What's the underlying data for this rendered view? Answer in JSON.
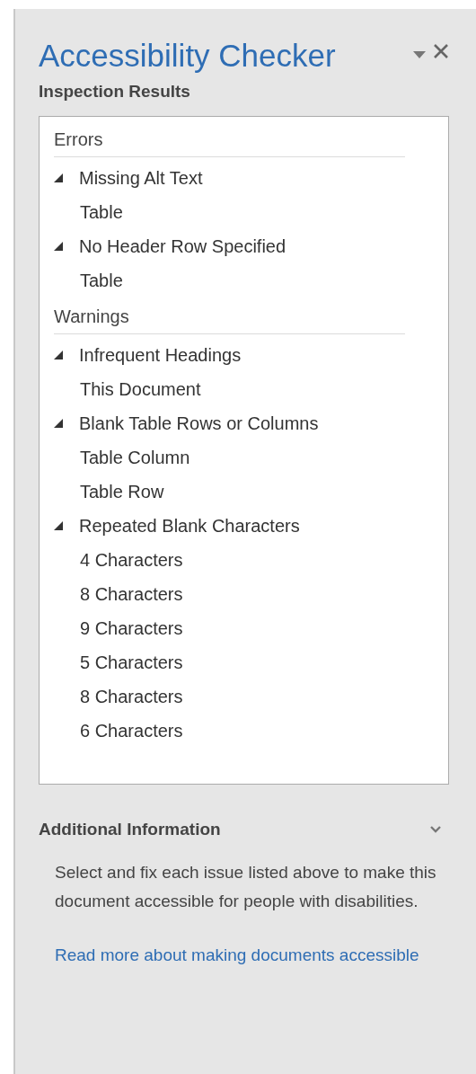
{
  "pane": {
    "title": "Accessibility Checker",
    "subtitle": "Inspection Results"
  },
  "groups": [
    {
      "label": "Errors",
      "issues": [
        {
          "label": "Missing Alt Text",
          "expanded": true,
          "children": [
            {
              "label": "Table"
            }
          ]
        },
        {
          "label": "No Header Row Specified",
          "expanded": true,
          "children": [
            {
              "label": "Table"
            }
          ]
        }
      ]
    },
    {
      "label": "Warnings",
      "issues": [
        {
          "label": "Infrequent Headings",
          "expanded": true,
          "children": [
            {
              "label": "This Document"
            }
          ]
        },
        {
          "label": "Blank Table Rows or Columns",
          "expanded": true,
          "children": [
            {
              "label": "Table Column"
            },
            {
              "label": "Table Row"
            }
          ]
        },
        {
          "label": "Repeated Blank Characters",
          "expanded": true,
          "children": [
            {
              "label": "4 Characters"
            },
            {
              "label": "8 Characters"
            },
            {
              "label": "9 Characters"
            },
            {
              "label": "5 Characters"
            },
            {
              "label": "8 Characters"
            },
            {
              "label": "6 Characters"
            }
          ]
        }
      ]
    }
  ],
  "additional": {
    "title": "Additional Information",
    "expanded": true,
    "text": "Select and fix each issue listed above to make this document accessible for people with disabilities.",
    "link": "Read more about making documents accessible"
  }
}
